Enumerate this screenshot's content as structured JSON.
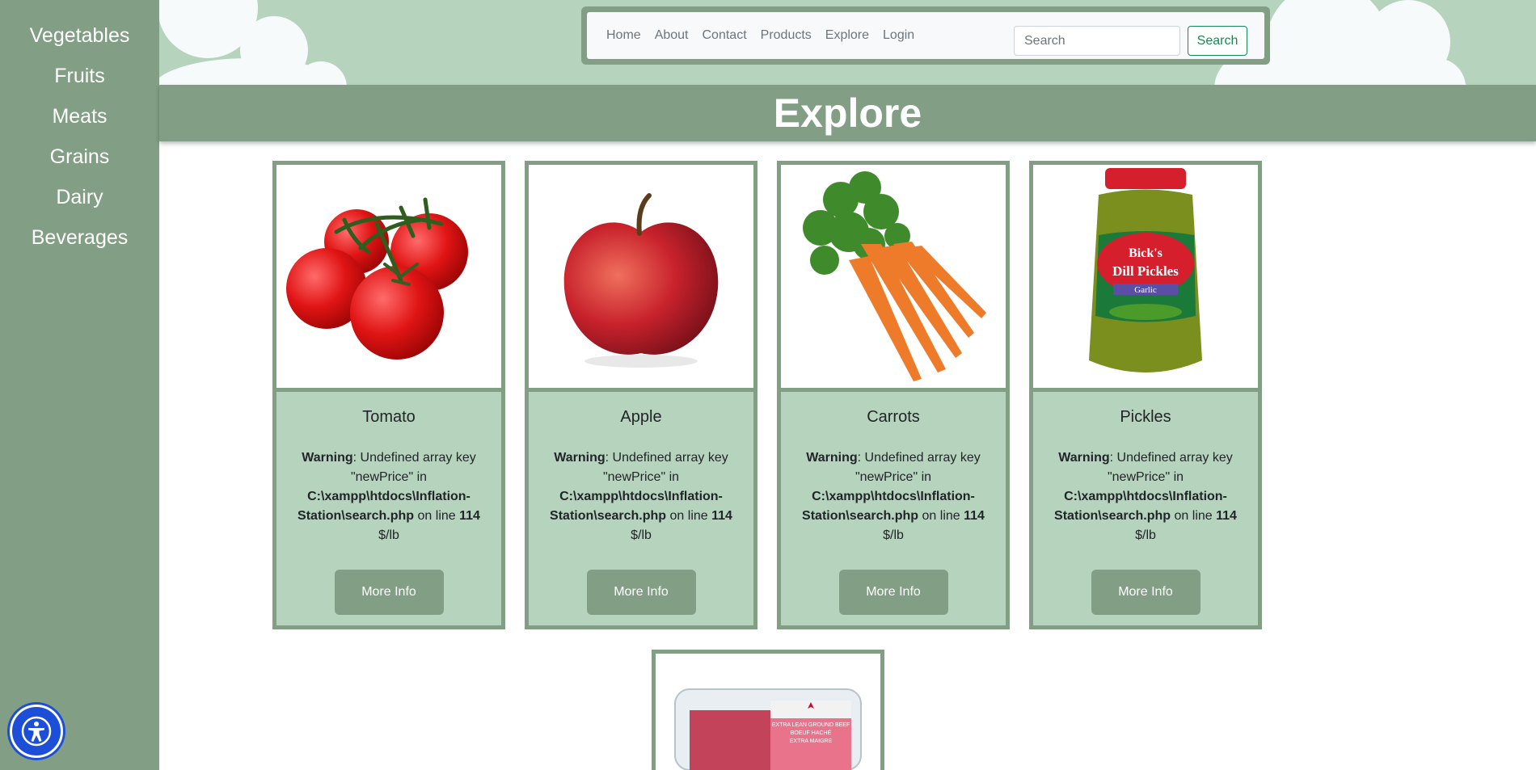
{
  "sidebar": {
    "items": [
      {
        "label": "Vegetables"
      },
      {
        "label": "Fruits"
      },
      {
        "label": "Meats"
      },
      {
        "label": "Grains"
      },
      {
        "label": "Dairy"
      },
      {
        "label": "Beverages"
      }
    ]
  },
  "nav": {
    "links": [
      "Home",
      "About",
      "Contact",
      "Products",
      "Explore",
      "Login"
    ],
    "search_placeholder": "Search",
    "search_button": "Search"
  },
  "page": {
    "title": "Explore"
  },
  "products": [
    {
      "name": "Tomato",
      "warning_label": "Warning",
      "warning_text": ": Undefined array key \"newPrice\" in",
      "path": "C:\\xampp\\htdocs\\Inflation-Station\\search.php",
      "on_line": " on line ",
      "line": "114",
      "unit": "$/lb",
      "button": "More Info"
    },
    {
      "name": "Apple",
      "warning_label": "Warning",
      "warning_text": ": Undefined array key \"newPrice\" in",
      "path": "C:\\xampp\\htdocs\\Inflation-Station\\search.php",
      "on_line": " on line ",
      "line": "114",
      "unit": "$/lb",
      "button": "More Info"
    },
    {
      "name": "Carrots",
      "warning_label": "Warning",
      "warning_text": ": Undefined array key \"newPrice\" in",
      "path": "C:\\xampp\\htdocs\\Inflation-Station\\search.php",
      "on_line": " on line ",
      "line": "114",
      "unit": "$/lb",
      "button": "More Info"
    },
    {
      "name": "Pickles",
      "warning_label": "Warning",
      "warning_text": ": Undefined array key \"newPrice\" in",
      "path": "C:\\xampp\\htdocs\\Inflation-Station\\search.php",
      "on_line": " on line ",
      "line": "114",
      "unit": "$/lb",
      "button": "More Info"
    }
  ],
  "pickle_jar": {
    "brand": "Bick's",
    "product": "Dill Pickles",
    "variant": "Garlic"
  },
  "meat_package": {
    "line1": "EXTRA LEAN GROUND BEEF",
    "line2": "BOEUF HACHÉ",
    "line3": "EXTRA MAIGRE"
  },
  "colors": {
    "sidebar": "#829f85",
    "band": "#b6d4bd",
    "accent": "#198754",
    "access": "#1d4ed8"
  }
}
